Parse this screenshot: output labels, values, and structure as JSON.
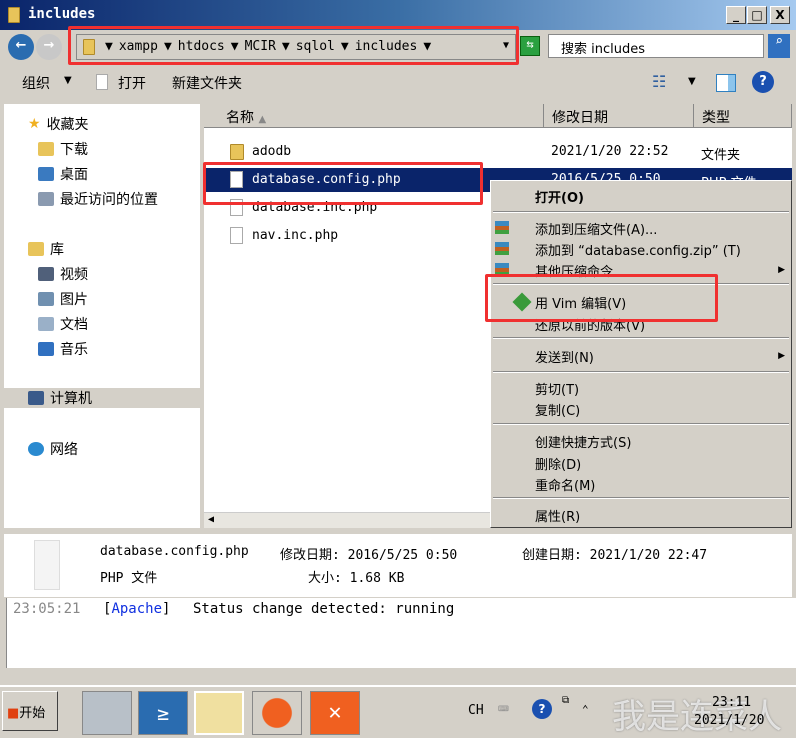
{
  "window": {
    "title": "includes",
    "minimize": "_",
    "maximize": "□",
    "close": "X"
  },
  "address": {
    "segments": [
      "xampp",
      "htdocs",
      "MCIR",
      "sqlol",
      "includes"
    ],
    "search_placeholder": "搜索 includes"
  },
  "toolbar": {
    "organize": "组织",
    "open": "打开",
    "new_folder": "新建文件夹"
  },
  "nav": {
    "favorites": "收藏夹",
    "downloads": "下载",
    "desktop": "桌面",
    "recent": "最近访问的位置",
    "libraries": "库",
    "videos": "视频",
    "pictures": "图片",
    "documents": "文档",
    "music": "音乐",
    "computer": "计算机",
    "network": "网络"
  },
  "columns": {
    "name": "名称",
    "modified": "修改日期",
    "type": "类型"
  },
  "files": [
    {
      "name": "adodb",
      "modified": "2021/1/20 22:52",
      "type": "文件夹"
    },
    {
      "name": "database.config.php",
      "modified": "2016/5/25 0:50",
      "type": "PHP 文件"
    },
    {
      "name": "database.inc.php",
      "modified": "",
      "type": ""
    },
    {
      "name": "nav.inc.php",
      "modified": "",
      "type": ""
    }
  ],
  "context_menu": {
    "open": "打开(O)",
    "add_archive": "添加到压缩文件(A)...",
    "add_zip": "添加到 “database.config.zip” (T)",
    "other_compress": "其他压缩命令",
    "vim": "用 Vim 编辑(V)",
    "restore": "还原以前的版本(V)",
    "send_to": "发送到(N)",
    "cut": "剪切(T)",
    "copy": "复制(C)",
    "shortcut": "创建快捷方式(S)",
    "delete": "删除(D)",
    "rename": "重命名(M)",
    "properties": "属性(R)"
  },
  "details": {
    "filename": "database.config.php",
    "modified": "修改日期: 2016/5/25 0:50",
    "created": "创建日期: 2021/1/20 22:47",
    "type": "PHP 文件",
    "size": "大小: 1.68 KB"
  },
  "log": {
    "time": "23:05:21",
    "module": "Apache",
    "message": "Status change detected: running"
  },
  "taskbar": {
    "start": "开始",
    "lang": "CH",
    "time": "23:11",
    "date": "2021/1/20"
  },
  "watermark": "我是连菜人"
}
